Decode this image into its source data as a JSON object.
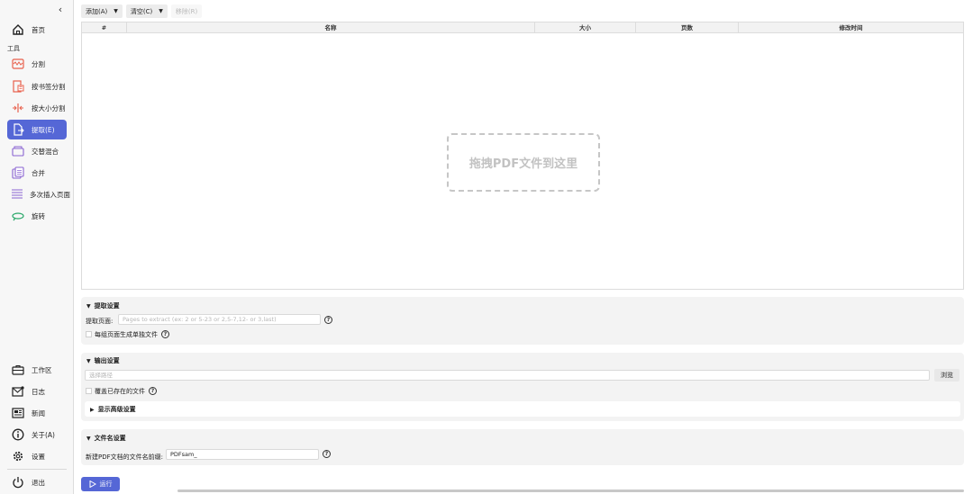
{
  "sidebar": {
    "collapse_icon": "chevron-left-icon",
    "home": {
      "label": "首页",
      "icon": "home-icon"
    },
    "tools_label": "工具",
    "tools": [
      {
        "label": "分割",
        "icon": "split-icon"
      },
      {
        "label": "按书签分割",
        "icon": "bookmark-split-icon"
      },
      {
        "label": "按大小分割",
        "icon": "size-split-icon"
      },
      {
        "label": "提取(E)",
        "icon": "extract-icon",
        "active": true
      },
      {
        "label": "交替混合",
        "icon": "alternate-mix-icon"
      },
      {
        "label": "合并",
        "icon": "merge-icon"
      },
      {
        "label": "多次插入页面",
        "icon": "insert-pages-icon"
      },
      {
        "label": "旋转",
        "icon": "rotate-icon"
      }
    ],
    "bottom": [
      {
        "label": "工作区",
        "icon": "briefcase-icon"
      },
      {
        "label": "日志",
        "icon": "log-icon"
      },
      {
        "label": "新闻",
        "icon": "news-icon"
      },
      {
        "label": "关于(A)",
        "icon": "info-icon"
      },
      {
        "label": "设置",
        "icon": "gear-icon"
      },
      {
        "label": "退出",
        "icon": "power-icon"
      }
    ]
  },
  "toolbar": {
    "add_label": "添加(A)",
    "clear_label": "清空(C)",
    "remove_label": "移除(R)"
  },
  "table": {
    "columns": [
      "#",
      "名称",
      "大小",
      "页数",
      "修改时间"
    ],
    "drop_text": "拖拽PDF文件到这里"
  },
  "extract_settings": {
    "title": "提取设置",
    "pages_label": "提取页面:",
    "pages_placeholder": "Pages to extract (ex: 2 or 5-23 or 2,5-7,12- or 3,last)",
    "separate_files_label": "每组页面生成单独文件"
  },
  "output_settings": {
    "title": "输出设置",
    "path_placeholder": "选择路径",
    "browse_label": "浏览",
    "overwrite_label": "覆盖已存在的文件",
    "advanced_label": "显示高级设置"
  },
  "filename_settings": {
    "title": "文件名设置",
    "prefix_label": "新建PDF文档的文件名前缀:",
    "prefix_value": "PDFsam_"
  },
  "run": {
    "label": "运行"
  },
  "colors": {
    "accent": "#5567d6",
    "split": "#e8604c",
    "rotate": "#2aa86a",
    "purple": "#8a63d2"
  }
}
